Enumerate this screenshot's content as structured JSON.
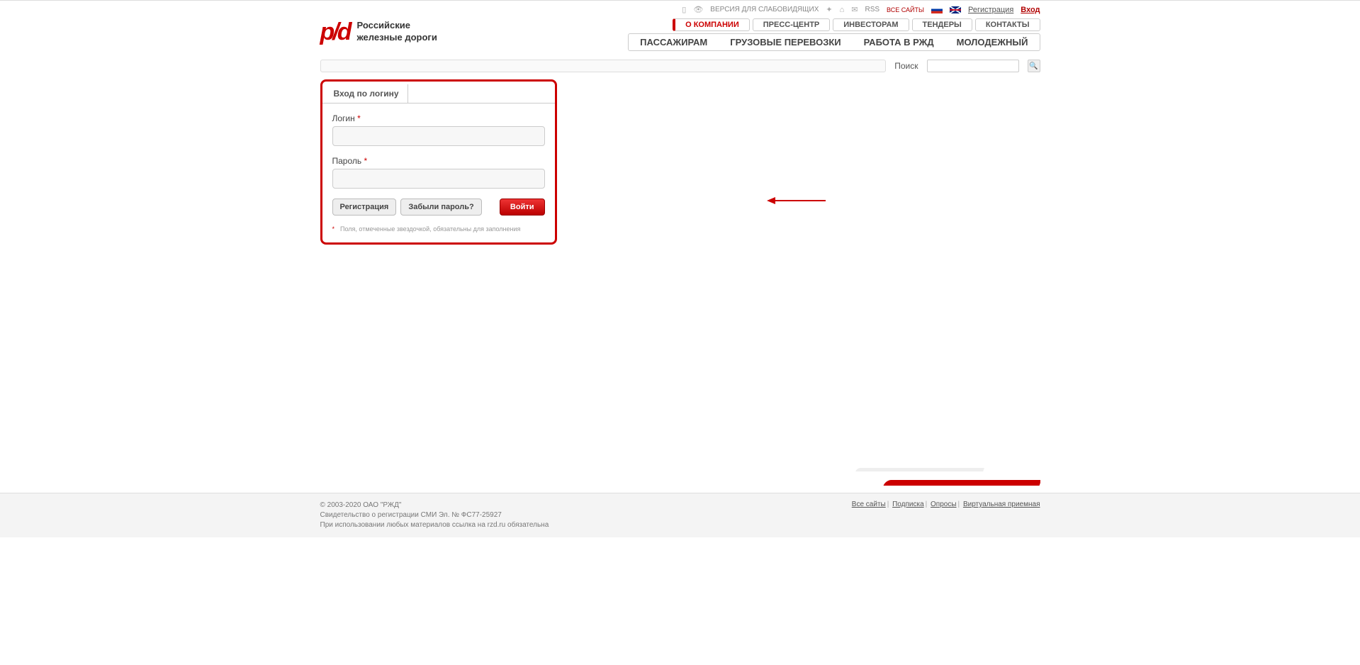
{
  "utility": {
    "accessibility": "ВЕРСИЯ ДЛЯ СЛАБОВИДЯЩИХ",
    "rss": "RSS",
    "all_sites": "ВСЕ САЙТЫ",
    "register": "Регистрация",
    "login": "Вход"
  },
  "logo": {
    "mark": "p/d",
    "line1": "Российские",
    "line2": "железные дороги"
  },
  "nav_tabs": [
    "О КОМПАНИИ",
    "ПРЕСС-ЦЕНТР",
    "ИНВЕСТОРАМ",
    "ТЕНДЕРЫ",
    "КОНТАКТЫ"
  ],
  "nav_main": [
    "ПАССАЖИРАМ",
    "ГРУЗОВЫЕ ПЕРЕВОЗКИ",
    "РАБОТА В РЖД",
    "МОЛОДЕЖНЫЙ"
  ],
  "search_label": "Поиск",
  "login_form": {
    "tab": "Вход по логину",
    "login_label": "Логин",
    "password_label": "Пароль",
    "register_btn": "Регистрация",
    "forgot_btn": "Забыли пароль?",
    "submit_btn": "Войти",
    "note": "Поля, отмеченные звездочкой, обязательны для заполнения",
    "req": "*"
  },
  "footer": {
    "copyright": "© 2003-2020 ОАО \"РЖД\"",
    "cert": "Свидетельство о регистрации СМИ Эл. № ФС77-25927",
    "usage": "При использовании любых материалов ссылка на rzd.ru обязательна",
    "links": [
      "Все сайты",
      "Подписка",
      "Опросы",
      "Виртуальная приемная"
    ]
  }
}
